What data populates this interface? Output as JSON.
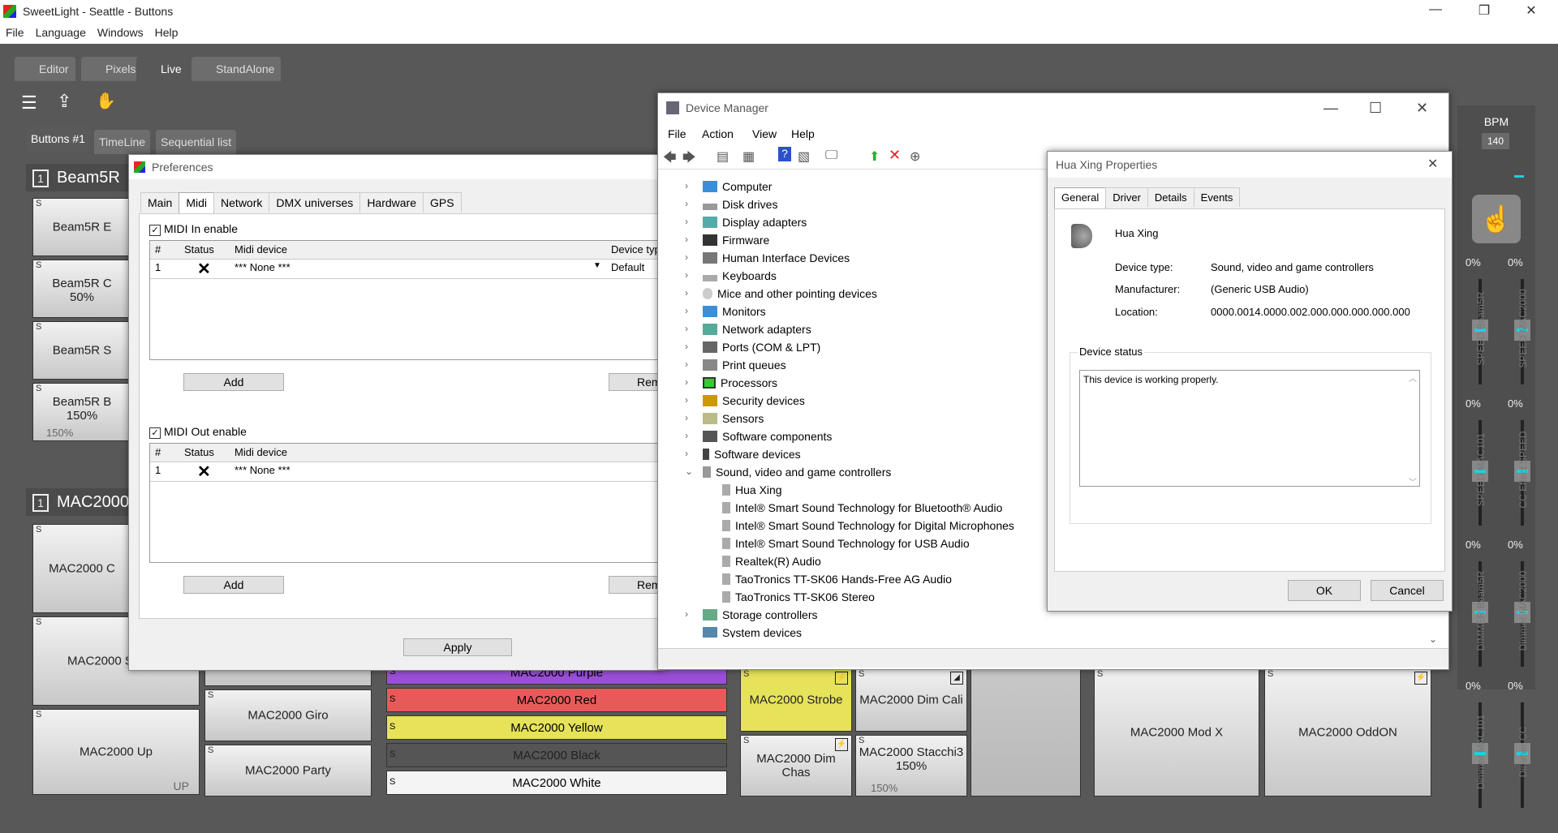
{
  "app": {
    "title": "SweetLight - Seattle - Buttons",
    "menu": [
      "File",
      "Language",
      "Windows",
      "Help"
    ],
    "tabs": [
      "Editor",
      "Pixels",
      "Live",
      "StandAlone"
    ],
    "subtabs": [
      "Buttons #1",
      "TimeLine",
      "Sequential list"
    ],
    "groups": [
      {
        "num": "1",
        "name": "Beam5R"
      },
      {
        "num": "1",
        "name": "MAC2000"
      }
    ],
    "beam_buttons": [
      {
        "label": "Beam5R E",
        "sub": ""
      },
      {
        "label": "Beam5R C",
        "sub": "50%"
      },
      {
        "label": "Beam5R S",
        "sub": ""
      },
      {
        "label": "Beam5R B",
        "sub": "150%",
        "foot": "150%"
      }
    ],
    "mac_buttons_left": [
      {
        "label": "MAC2000 C"
      },
      {
        "label": "MAC2000 S"
      },
      {
        "label": "MAC2000 Up",
        "foot": "UP"
      }
    ],
    "mac_buttons_col2": [
      "MAC2000 Giro",
      "MAC2000 Party"
    ],
    "color_buttons": [
      {
        "label": "MAC2000 Purple",
        "color": "#9b4fd6"
      },
      {
        "label": "MAC2000 Red",
        "color": "#e85a5a"
      },
      {
        "label": "MAC2000 Yellow",
        "color": "#e6e35a"
      },
      {
        "label": "MAC2000 Black",
        "color": "#555555"
      },
      {
        "label": "MAC2000 White",
        "color": "#f4f4f4"
      }
    ],
    "fx_buttons": [
      "MAC2000 Strobe",
      "MAC2000 Dim Cali",
      "MAC2000 Dim Chas",
      "MAC2000 Stacchi3"
    ],
    "fx_sub": "150%",
    "fx_foot": "150%",
    "mod_buttons": [
      "MAC2000 Mod X",
      "MAC2000 OddON"
    ],
    "bpm": {
      "label": "BPM",
      "value": "140"
    },
    "faders": [
      {
        "pct": "0%",
        "name": "SPEED Beam5R"
      },
      {
        "pct": "0%",
        "name": "SPEED MAC2000"
      },
      {
        "pct": "0%",
        "name": "SPEED MAC101"
      },
      {
        "pct": "0%",
        "name": "CC Effect SPEED"
      },
      {
        "pct": "0%",
        "name": "DIMMER Beam5R"
      },
      {
        "pct": "0%",
        "name": "Dimmer MAC2000"
      },
      {
        "pct": "0%",
        "name": "Dimmer MAC101"
      },
      {
        "pct": "0%",
        "name": "Dimmer CC"
      }
    ]
  },
  "preferences": {
    "title": "Preferences",
    "tabs": [
      "Main",
      "Midi",
      "Network",
      "DMX universes",
      "Hardware",
      "GPS"
    ],
    "midi_in": {
      "label": "MIDI In enable",
      "cols": [
        "#",
        "Status",
        "Midi device",
        "Device typ"
      ],
      "row": {
        "num": "1",
        "device": "*** None ***",
        "type": "Default"
      }
    },
    "midi_out": {
      "label": "MIDI Out enable",
      "cols": [
        "#",
        "Status",
        "Midi device"
      ],
      "row": {
        "num": "1",
        "device": "*** None ***"
      }
    },
    "add": "Add",
    "remove": "Rem",
    "apply": "Apply"
  },
  "device_manager": {
    "title": "Device Manager",
    "menu": [
      "File",
      "Action",
      "View",
      "Help"
    ],
    "categories": [
      "Computer",
      "Disk drives",
      "Display adapters",
      "Firmware",
      "Human Interface Devices",
      "Keyboards",
      "Mice and other pointing devices",
      "Monitors",
      "Network adapters",
      "Ports (COM & LPT)",
      "Print queues",
      "Processors",
      "Security devices",
      "Sensors",
      "Software components",
      "Software devices",
      "Sound, video and game controllers"
    ],
    "sound_children": [
      "Hua Xing",
      "Intel® Smart Sound Technology for Bluetooth® Audio",
      "Intel® Smart Sound Technology for Digital Microphones",
      "Intel® Smart Sound Technology for USB Audio",
      "Realtek(R) Audio",
      "TaoTronics TT-SK06 Hands-Free AG Audio",
      "TaoTronics TT-SK06 Stereo"
    ],
    "after": [
      "Storage controllers",
      "System devices"
    ]
  },
  "properties": {
    "title": "Hua Xing Properties",
    "tabs": [
      "General",
      "Driver",
      "Details",
      "Events"
    ],
    "device_name": "Hua Xing",
    "device_type_label": "Device type:",
    "device_type": "Sound, video and game controllers",
    "manufacturer_label": "Manufacturer:",
    "manufacturer": "(Generic USB Audio)",
    "location_label": "Location:",
    "location": "0000.0014.0000.002.000.000.000.000.000",
    "status_label": "Device status",
    "status_text": "This device is working properly.",
    "ok": "OK",
    "cancel": "Cancel"
  }
}
